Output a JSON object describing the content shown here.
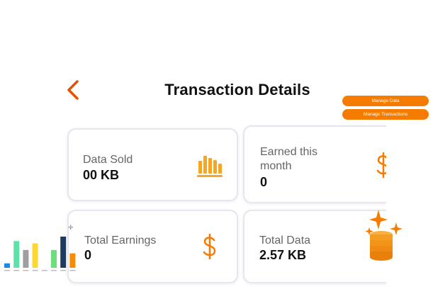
{
  "header": {
    "title": "Transaction Details"
  },
  "actions": {
    "manage_data": "Manage Data",
    "manage_transactions": "Manage Transactions"
  },
  "cards": [
    {
      "label": "Data Sold",
      "value": "00 KB",
      "icon": "bar-chart-icon"
    },
    {
      "label": "Earned this month",
      "value": "0",
      "icon": "dollar-icon"
    },
    {
      "label": "Total Earnings",
      "value": "0",
      "icon": "dollar-icon"
    },
    {
      "label": "Total Data",
      "value": "2.57 KB",
      "icon": "coins-sparkle-icon"
    }
  ],
  "colors": {
    "accent": "#f57c00",
    "card_border": "#e6e6ee",
    "title": "#111111"
  },
  "mini_chart": {
    "values": [
      4,
      24,
      16,
      22,
      3,
      16,
      28,
      13
    ],
    "colors": [
      "#1e88e5",
      "#5de3a8",
      "#9e9e9e",
      "#fdd835",
      "#ffffff",
      "#69e07a",
      "#1f3a5f",
      "#fb8c00"
    ]
  }
}
